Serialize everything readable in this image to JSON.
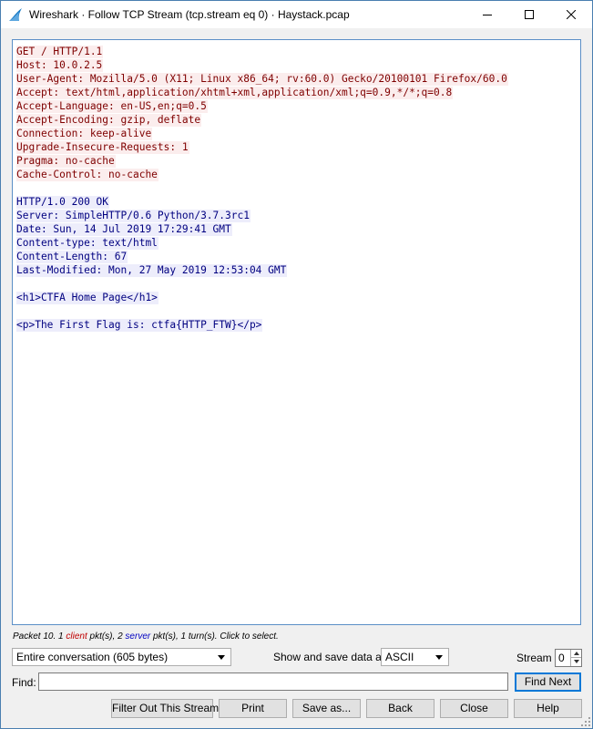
{
  "window": {
    "title": "Wireshark · Follow TCP Stream (tcp.stream eq 0) · Haystack.pcap",
    "icon": "wireshark-fin-icon",
    "controls": [
      "minimize-icon",
      "maximize-icon",
      "close-icon"
    ]
  },
  "stream": {
    "client_request": [
      "GET / HTTP/1.1",
      "Host: 10.0.2.5",
      "User-Agent: Mozilla/5.0 (X11; Linux x86_64; rv:60.0) Gecko/20100101 Firefox/60.0",
      "Accept: text/html,application/xhtml+xml,application/xml;q=0.9,*/*;q=0.8",
      "Accept-Language: en-US,en;q=0.5",
      "Accept-Encoding: gzip, deflate",
      "Connection: keep-alive",
      "Upgrade-Insecure-Requests: 1",
      "Pragma: no-cache",
      "Cache-Control: no-cache"
    ],
    "server_headers": [
      "HTTP/1.0 200 OK",
      "Server: SimpleHTTP/0.6 Python/3.7.3rc1",
      "Date: Sun, 14 Jul 2019 17:29:41 GMT",
      "Content-type: text/html",
      "Content-Length: 67",
      "Last-Modified: Mon, 27 May 2019 12:53:04 GMT"
    ],
    "server_body": [
      "<h1>CTFA Home Page</h1>",
      "<p>The First Flag is: ctfa{HTTP_FTW}</p>"
    ],
    "colors": {
      "client_text": "#7f0000",
      "client_bg": "#fbeded",
      "server_text": "#000080",
      "server_bg": "#ededfb"
    }
  },
  "status": {
    "prefix": "Packet 10. 1 ",
    "client_word": "client",
    "mid": " pkt(s), 2 ",
    "server_word": "server",
    "suffix": " pkt(s), 1 turn(s). Click to select."
  },
  "controls": {
    "conversation_select": "Entire conversation (605 bytes)",
    "show_save_label": "Show and save data as",
    "format_select": "ASCII",
    "stream_label": "Stream",
    "stream_value": "0",
    "find_label": "Find:",
    "find_value": "",
    "find_next": "Find Next"
  },
  "buttons": {
    "filter_out": "Filter Out This Stream",
    "print": "Print",
    "save_as": "Save as...",
    "back": "Back",
    "close": "Close",
    "help": "Help"
  }
}
